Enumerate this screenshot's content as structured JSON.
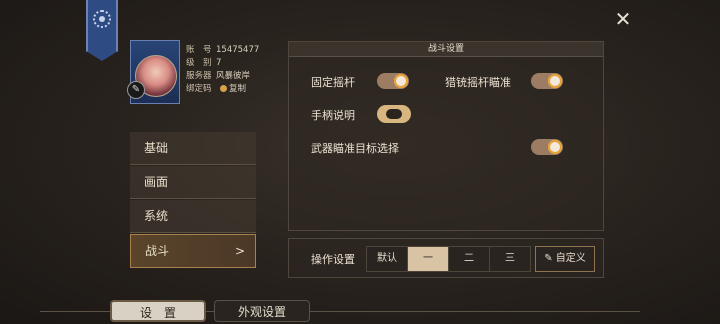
{
  "profile": {
    "account_label": "账　号",
    "account_value": "15475477",
    "level_label": "级　别",
    "level_value": "7",
    "server_label": "服务器",
    "server_value": "风暴彼岸",
    "bind_label": "绑定码",
    "copy_label": "复制"
  },
  "nav": {
    "items": [
      {
        "label": "基础"
      },
      {
        "label": "画面"
      },
      {
        "label": "系统"
      },
      {
        "label": "战斗",
        "arrow": ">"
      }
    ]
  },
  "panel": {
    "title": "战斗设置",
    "fixed_joystick": "固定摇杆",
    "sniper_aim": "猎铳摇杆瞄准",
    "controller_help": "手柄说明",
    "weapon_target": "武器瞄准目标选择"
  },
  "op": {
    "label": "操作设置",
    "default": "默认",
    "one": "一",
    "two": "二",
    "three": "三",
    "custom": "自定义"
  },
  "tabs": {
    "settings": "设　置",
    "appearance": "外观设置"
  },
  "close": "✕"
}
